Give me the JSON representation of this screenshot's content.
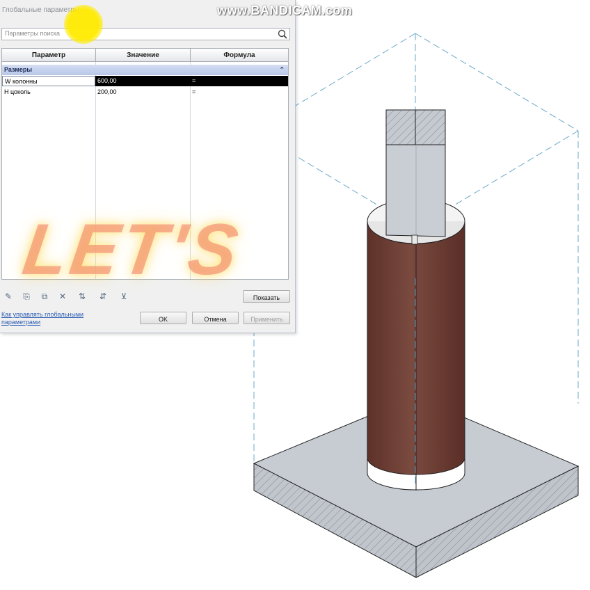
{
  "watermark": "www.BANDICAM.com",
  "overlay_text": "LET'S",
  "dialog": {
    "title": "Глобальные параметры",
    "search_placeholder": "Параметры поиска",
    "columns": [
      "Параметр",
      "Значение",
      "Формула"
    ],
    "group_label": "Размеры",
    "group_collapse": "⌃",
    "rows": [
      {
        "param": "W колонны",
        "value": "600,00",
        "formula": "=",
        "selected": true
      },
      {
        "param": "H цоколь",
        "value": "200,00",
        "formula": "=",
        "selected": false
      }
    ],
    "show_button": "Показать",
    "help_link": "Как управлять глобальными параметрами",
    "ok_button": "OK",
    "cancel_button": "Отмена",
    "apply_button": "Применить"
  },
  "colors": {
    "accent_group": "#c2cfee",
    "selected_row": "#000000",
    "column_body": "#6d3e35",
    "concrete": "#c7ccd3",
    "dashed_frame": "#6aa8c8"
  },
  "icons": [
    "pencil-icon",
    "new-parameter-icon",
    "duplicate-icon",
    "delete-icon",
    "sort-ascending-icon",
    "sort-descending-icon",
    "filter-icon"
  ]
}
